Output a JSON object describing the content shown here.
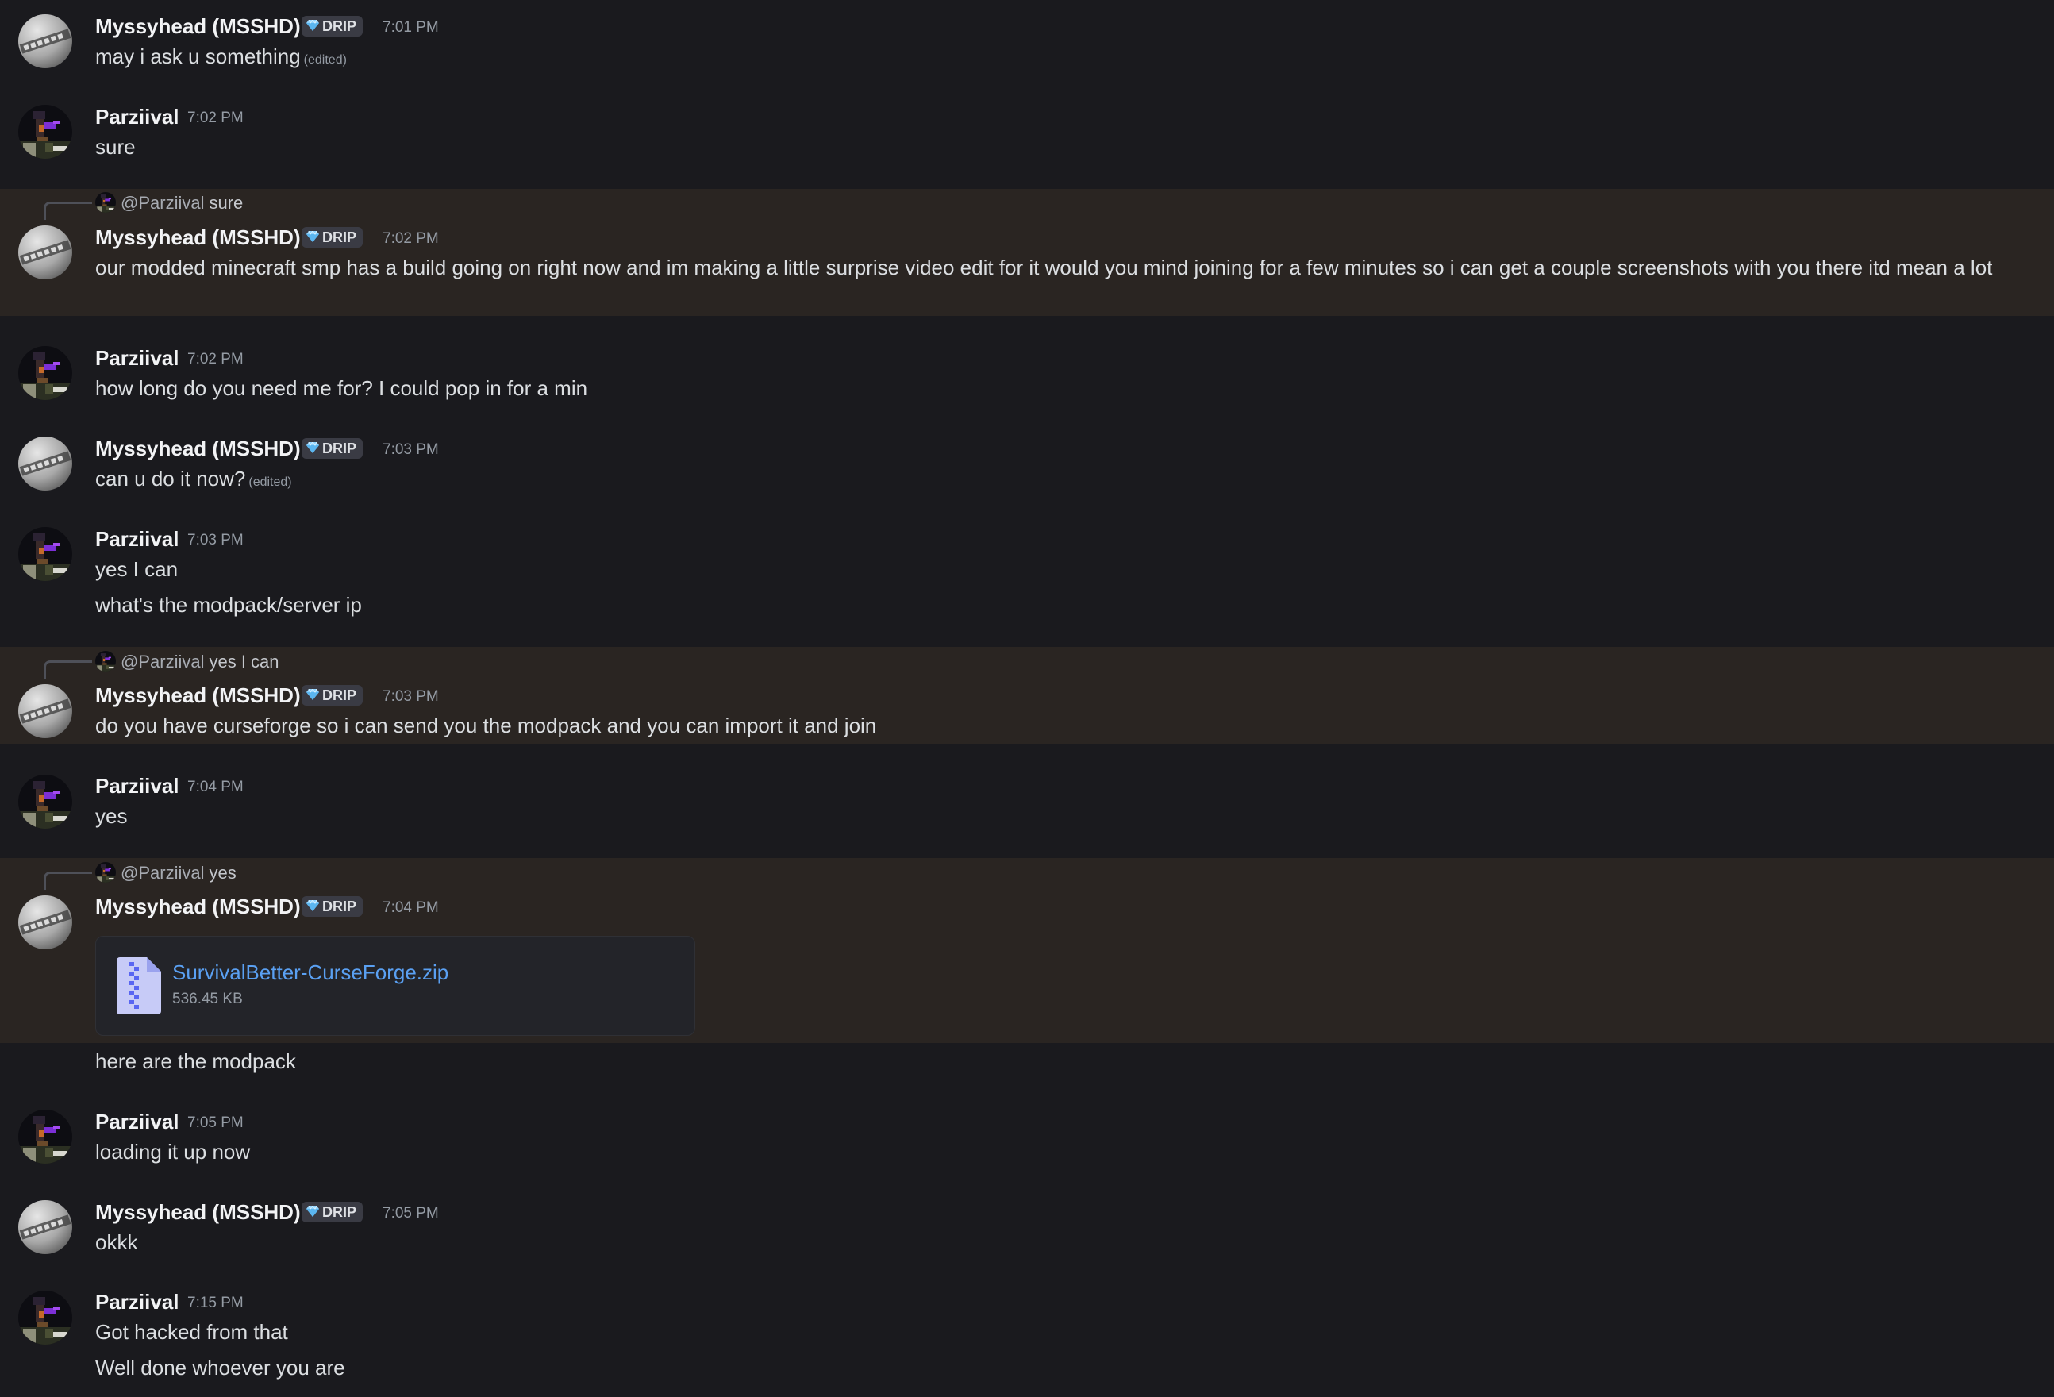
{
  "users": {
    "mysshd": {
      "name": "Myssyhead (MSSHD)",
      "badge": "DRIP",
      "avatar_icon": "mssshd-avatar-icon"
    },
    "parz": {
      "name": "Parziival",
      "avatar_icon": "pixel-art-avatar-icon"
    }
  },
  "colors": {
    "background": "#1a1a1e",
    "highlight": "#2a2522",
    "link": "#5aa0f2",
    "timestamp": "#949ba4"
  },
  "edited_label": "(edited)",
  "messages": [
    {
      "author": "Myssyhead (MSSHD)",
      "badge": "DRIP",
      "time": "7:01 PM",
      "lines": [
        "may i ask u something"
      ],
      "edited": true
    },
    {
      "author": "Parziival",
      "time": "7:02 PM",
      "lines": [
        "sure"
      ]
    },
    {
      "reply": {
        "mention": "@Parziival",
        "text": "sure"
      },
      "author": "Myssyhead (MSSHD)",
      "badge": "DRIP",
      "time": "7:02 PM",
      "lines": [
        "our modded minecraft smp has a build going on right now and im making a little surprise video edit for it would you mind joining for a few minutes so i can get a couple screenshots with you there itd mean a lot"
      ]
    },
    {
      "author": "Parziival",
      "time": "7:02 PM",
      "lines": [
        "how long do you need me for? I could pop in for a min"
      ]
    },
    {
      "author": "Myssyhead (MSSHD)",
      "badge": "DRIP",
      "time": "7:03 PM",
      "lines": [
        "can u do it now?"
      ],
      "edited": true
    },
    {
      "author": "Parziival",
      "time": "7:03 PM",
      "lines": [
        "yes I can",
        "what's the modpack/server ip"
      ]
    },
    {
      "reply": {
        "mention": "@Parziival",
        "text": "yes I can"
      },
      "author": "Myssyhead (MSSHD)",
      "badge": "DRIP",
      "time": "7:03 PM",
      "lines": [
        "do you have curseforge so i can send you the modpack and you can import it and join"
      ]
    },
    {
      "author": "Parziival",
      "time": "7:04 PM",
      "lines": [
        "yes"
      ]
    },
    {
      "reply": {
        "mention": "@Parziival",
        "text": "yes"
      },
      "author": "Myssyhead (MSSHD)",
      "badge": "DRIP",
      "time": "7:04 PM",
      "attachment": {
        "filename": "SurvivalBetter-CurseForge.zip",
        "size": "536.45 KB",
        "icon": "zip-file-icon"
      },
      "followup": [
        "here are the modpack"
      ]
    },
    {
      "author": "Parziival",
      "time": "7:05 PM",
      "lines": [
        "loading it up now"
      ]
    },
    {
      "author": "Myssyhead (MSSHD)",
      "badge": "DRIP",
      "time": "7:05 PM",
      "lines": [
        "okkk"
      ]
    },
    {
      "author": "Parziival",
      "time": "7:15 PM",
      "lines": [
        "Got hacked from that",
        "Well done whoever you are"
      ]
    }
  ]
}
